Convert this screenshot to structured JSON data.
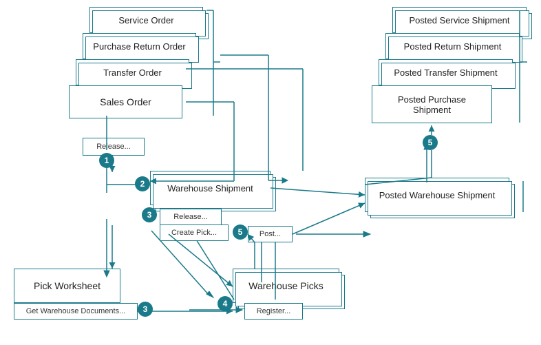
{
  "boxes": {
    "service_order": {
      "label": "Service Order"
    },
    "purchase_return_order": {
      "label": "Purchase Return Order"
    },
    "transfer_order": {
      "label": "Transfer Order"
    },
    "sales_order": {
      "label": "Sales Order"
    },
    "release_btn": {
      "label": "Release..."
    },
    "warehouse_shipment": {
      "label": "Warehouse Shipment"
    },
    "release_btn2": {
      "label": "Release..."
    },
    "create_pick_btn": {
      "label": "Create Pick..."
    },
    "post_btn": {
      "label": "Post..."
    },
    "pick_worksheet": {
      "label": "Pick Worksheet"
    },
    "get_warehouse_doc_btn": {
      "label": "Get Warehouse Documents..."
    },
    "warehouse_picks": {
      "label": "Warehouse Picks"
    },
    "register_btn": {
      "label": "Register..."
    },
    "posted_service_shipment": {
      "label": "Posted Service Shipment"
    },
    "posted_return_shipment": {
      "label": "Posted Return Shipment"
    },
    "posted_transfer_shipment": {
      "label": "Posted Transfer Shipment"
    },
    "posted_purchase_shipment": {
      "label": "Posted Purchase\nShipment"
    },
    "posted_warehouse_shipment": {
      "label": "Posted Warehouse Shipment"
    }
  },
  "numbers": [
    "1",
    "2",
    "3",
    "3",
    "4",
    "5",
    "5"
  ],
  "colors": {
    "teal": "#1a7a8a",
    "white": "#ffffff"
  }
}
